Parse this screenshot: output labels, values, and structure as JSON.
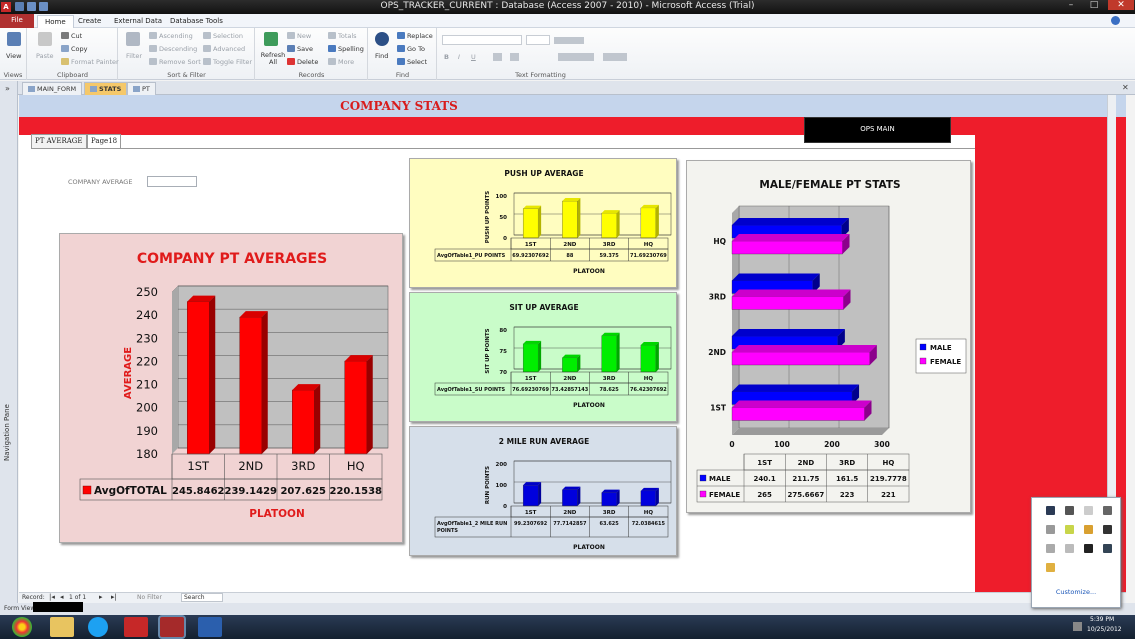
{
  "window": {
    "title": "OPS_TRACKER_CURRENT : Database (Access 2007 - 2010) - Microsoft Access (Trial)",
    "app_icon": "A",
    "minimize": "–",
    "maximize": "□",
    "close": "✕"
  },
  "ribbon_tabs": [
    "File",
    "Home",
    "Create",
    "External Data",
    "Database Tools"
  ],
  "ribbon": {
    "views": {
      "view": "View",
      "label": "Views"
    },
    "clipboard": {
      "paste": "Paste",
      "cut": "Cut",
      "copy": "Copy",
      "format_painter": "Format Painter",
      "label": "Clipboard"
    },
    "sort_filter": {
      "filter": "Filter",
      "ascending": "Ascending",
      "descending": "Descending",
      "remove_sort": "Remove Sort",
      "selection": "Selection",
      "advanced": "Advanced",
      "toggle_filter": "Toggle Filter",
      "label": "Sort & Filter"
    },
    "records": {
      "refresh": "Refresh All",
      "new": "New",
      "save": "Save",
      "delete": "Delete",
      "totals": "Totals",
      "spelling": "Spelling",
      "more": "More",
      "label": "Records"
    },
    "find": {
      "find": "Find",
      "replace": "Replace",
      "goto": "Go To",
      "select": "Select",
      "label": "Find"
    },
    "text_formatting": {
      "bold": "B",
      "italic": "I",
      "underline": "U",
      "label": "Text Formatting"
    }
  },
  "doc_tabs": [
    "MAIN_FORM",
    "STATS",
    "PT"
  ],
  "nav_pane_label": "Navigation Pane",
  "form": {
    "header_title": "COMPANY STATS",
    "ops_main_button": "OPS MAIN",
    "tabs": [
      "PT AVERAGE",
      "Page18"
    ],
    "company_average_label": "COMPANY AVERAGE",
    "company_average_value": ""
  },
  "colors": {
    "header_red": "#ee1d2b",
    "title_red": "#d81c1c",
    "header_blue": "#c5d5ec",
    "company_bg": "#f1d3d3",
    "pushup_bg": "#fffdc0",
    "situp_bg": "#c9fcc9",
    "run_bg": "#d6dfea",
    "mf_bg": "#f3f3ef"
  },
  "chart_data": [
    {
      "type": "bar",
      "title": "COMPANY PT AVERAGES",
      "xlabel": "PLATOON",
      "ylabel": "AVERAGE",
      "categories": [
        "1ST",
        "2ND",
        "3RD",
        "HQ"
      ],
      "series": [
        {
          "name": "AvgOfTOTAL",
          "values": [
            245.8462,
            239.1429,
            207.625,
            220.1538
          ],
          "color": "#ff0000"
        }
      ],
      "ylim": [
        180,
        250
      ],
      "yticks": [
        180,
        190,
        200,
        210,
        220,
        230,
        240,
        250
      ],
      "grid": true,
      "data_table": true
    },
    {
      "type": "bar",
      "title": "PUSH UP AVERAGE",
      "xlabel": "PLATOON",
      "ylabel": "PUSH UP POINTS",
      "categories": [
        "1ST",
        "2ND",
        "3RD",
        "HQ"
      ],
      "series": [
        {
          "name": "AvgOfTable1_PU POINTS",
          "values": [
            69.92307692,
            88,
            59.375,
            71.69230769
          ],
          "color": "#ffff00"
        }
      ],
      "table_values": [
        "69.92307692",
        "88",
        "59.375",
        "71.69230769"
      ],
      "ylim": [
        0,
        100
      ],
      "yticks": [
        0,
        50,
        100
      ],
      "yticks_printed": [
        0,
        50,
        100
      ]
    },
    {
      "type": "bar",
      "title": "SIT UP AVERAGE",
      "xlabel": "PLATOON",
      "ylabel": "SIT UP POINTS",
      "categories": [
        "1ST",
        "2ND",
        "3RD",
        "HQ"
      ],
      "series": [
        {
          "name": "AvgOfTable1_SU POINTS",
          "values": [
            76.69230769,
            73.42857143,
            78.625,
            76.42307692
          ],
          "color": "#00ee00"
        }
      ],
      "table_values": [
        "76.69230769",
        "73.42857143",
        "78.625",
        "76.42307692"
      ],
      "ylim": [
        70,
        80
      ],
      "yticks": [
        70,
        75,
        80
      ],
      "yticks_printed": [
        70,
        75,
        80
      ]
    },
    {
      "type": "bar",
      "title": "2 MILE RUN AVERAGE",
      "xlabel": "PLATOON",
      "ylabel": "RUN POINTS",
      "categories": [
        "1ST",
        "2ND",
        "3RD",
        "HQ"
      ],
      "series": [
        {
          "name": "AvgOfTable1_2 MILE RUN POINTS",
          "values": [
            99.2307692,
            77.7142857,
            63.625,
            72.0384615
          ],
          "color": "#0000dd"
        }
      ],
      "table_values": [
        "99.2307692",
        "77.7142857",
        "63.625",
        "72.0384615"
      ],
      "ylim": [
        0,
        200
      ],
      "yticks": [
        0,
        100,
        200
      ],
      "yticks_printed": [
        0,
        100,
        200
      ]
    },
    {
      "type": "bar",
      "orientation": "horizontal",
      "title": "MALE/FEMALE PT STATS",
      "categories": [
        "1ST",
        "2ND",
        "3RD",
        "HQ"
      ],
      "series": [
        {
          "name": "MALE",
          "values": [
            240.1,
            211.75,
            161.5,
            219.7778
          ],
          "color": "#0000ff"
        },
        {
          "name": "FEMALE",
          "values": [
            265,
            275.6667,
            223,
            221
          ],
          "color": "#ff00ff"
        }
      ],
      "xlim": [
        0,
        300
      ],
      "xticks": [
        0,
        100,
        200,
        300
      ],
      "legend": "right",
      "data_table": true
    }
  ],
  "record_bar": {
    "label": "Record:",
    "position": "1 of 1",
    "filter": "No Filter",
    "search": "Search"
  },
  "status_bar": {
    "view": "Form View"
  },
  "tray": {
    "customize": "Customize...",
    "time": "5:39 PM",
    "date": "10/25/2012"
  }
}
